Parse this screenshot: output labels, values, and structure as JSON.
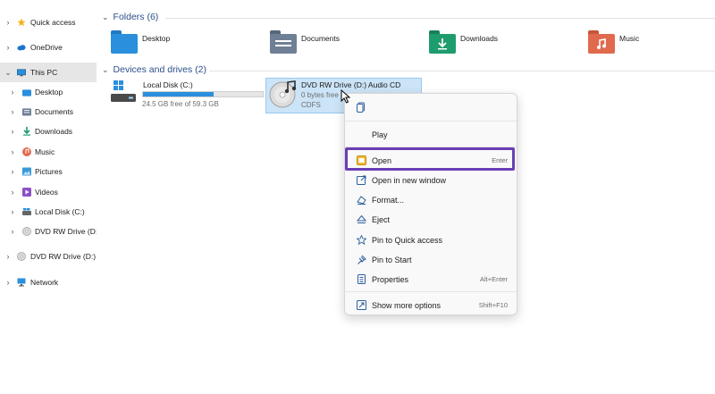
{
  "sidebar": {
    "items": [
      {
        "label": "Quick access",
        "icon": "star-icon"
      },
      {
        "label": "OneDrive",
        "icon": "cloud-icon"
      },
      {
        "label": "This PC",
        "icon": "monitor-icon",
        "selected": true
      },
      {
        "label": "Desktop",
        "icon": "desktop-folder-icon"
      },
      {
        "label": "Documents",
        "icon": "documents-icon"
      },
      {
        "label": "Downloads",
        "icon": "download-icon"
      },
      {
        "label": "Music",
        "icon": "music-icon"
      },
      {
        "label": "Pictures",
        "icon": "pictures-icon"
      },
      {
        "label": "Videos",
        "icon": "videos-icon"
      },
      {
        "label": "Local Disk (C:)",
        "icon": "disk-icon"
      },
      {
        "label": "DVD RW Drive (D:)",
        "icon": "dvd-icon"
      },
      {
        "label": "DVD RW Drive (D:) A",
        "icon": "dvd-icon"
      },
      {
        "label": "Network",
        "icon": "network-icon"
      }
    ]
  },
  "main": {
    "folders_heading": "Folders (6)",
    "folders": [
      {
        "label": "Desktop",
        "color": "#2a8fdc"
      },
      {
        "label": "Documents",
        "color": "#6f7f95"
      },
      {
        "label": "Downloads",
        "color": "#1f9c6d"
      },
      {
        "label": "Music",
        "color": "#e06a4e"
      }
    ],
    "drives_heading": "Devices and drives (2)",
    "drives": [
      {
        "name": "Local Disk (C:)",
        "free": "24.5 GB free of 59.3 GB",
        "used_fraction": 0.59
      },
      {
        "name": "DVD RW Drive (D:) Audio CD",
        "free": "0 bytes free",
        "fs": "CDFS"
      }
    ]
  },
  "context_menu": {
    "top_icon": "copy-icon",
    "items": [
      {
        "label": "Play",
        "icon": "",
        "shortcut": ""
      },
      {
        "label": "Open",
        "icon": "open-icon",
        "shortcut": "Enter"
      },
      {
        "label": "Open in new window",
        "icon": "new-window-icon",
        "shortcut": ""
      },
      {
        "label": "Format...",
        "icon": "format-icon",
        "shortcut": ""
      },
      {
        "label": "Eject",
        "icon": "eject-icon",
        "shortcut": ""
      },
      {
        "label": "Pin to Quick access",
        "icon": "star-outline-icon",
        "shortcut": ""
      },
      {
        "label": "Pin to Start",
        "icon": "pin-icon",
        "shortcut": ""
      },
      {
        "label": "Properties",
        "icon": "properties-icon",
        "shortcut": "Alt+Enter"
      },
      {
        "label": "Show more options",
        "icon": "more-options-icon",
        "shortcut": "Shift+F10"
      }
    ]
  },
  "colors": {
    "accent": "#2a8fdc",
    "highlight": "#6a3fb5",
    "selection": "#cce4f7"
  }
}
